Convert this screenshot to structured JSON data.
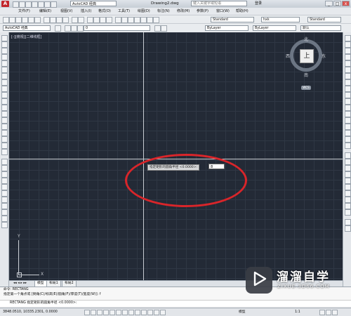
{
  "titlebar": {
    "app_logo": "A",
    "workspace": "AutoCAD 经典",
    "document_title": "Drawing2.dwg",
    "search_placeholder": "键入关键字或短语",
    "login": "登录",
    "window_controls": [
      "_",
      "□",
      "x"
    ]
  },
  "menubar": {
    "items": [
      "文件(F)",
      "编辑(E)",
      "视图(V)",
      "插入(I)",
      "格式(O)",
      "工具(T)",
      "绘图(D)",
      "标注(N)",
      "修改(M)",
      "参数(P)",
      "窗口(W)",
      "帮助(H)"
    ]
  },
  "toolbar": {
    "text_style": "Standard",
    "dim_style": "hxk",
    "table_style": "Standard",
    "workspace2": "AutoCAD 经典",
    "layer": "0",
    "color": "ByLayer",
    "linetype": "ByLayer",
    "lineweight": "默认"
  },
  "canvas": {
    "viewport_label": "[-][俯视][二维线框]",
    "tooltip_prompt": "指定矩形的圆角半径 <0.0000>:",
    "tooltip_value": "8",
    "highlight_color": "#d9252a",
    "background_color": "#232a36"
  },
  "viewcube": {
    "north": "北",
    "south": "南",
    "east": "东",
    "west": "西",
    "face": "上",
    "wcs": "WCS"
  },
  "ucs": {
    "x_label": "X",
    "y_label": "Y"
  },
  "tabs": [
    "模型",
    "布局1",
    "布局2"
  ],
  "command": {
    "line1": "命令: RECTANG",
    "line2": "指定第一个角点或 [倒角(C)/标高(E)/圆角(F)/厚度(T)/宽度(W)]: f",
    "line3": "RECTANG 指定矩形的圆角半径 <0.0000>:"
  },
  "statusbar": {
    "coordinates": "3848.0510, 10335.2301, 0.0000",
    "model": "模型",
    "scale": "1:1"
  },
  "watermark": {
    "name": "溜溜自学",
    "url": "ZIXUE.3D66.COM"
  }
}
